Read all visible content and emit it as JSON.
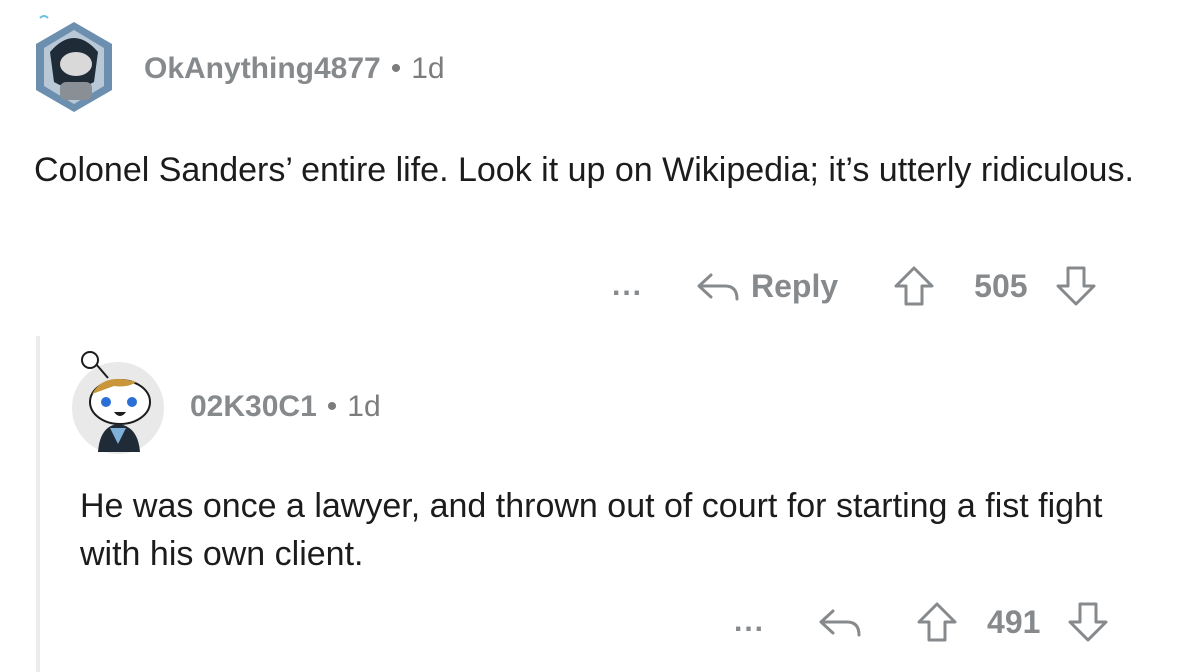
{
  "comments": [
    {
      "username": "OkAnything4877",
      "age": "1d",
      "body": "Colonel Sanders’ entire life. Look it up on Wikipedia; it’s utterly ridiculous.",
      "more": "...",
      "reply_label": "Reply",
      "score": "505"
    },
    {
      "username": "02K30C1",
      "age": "1d",
      "body": "He was once a lawyer, and thrown out of court for starting a fist fight with his own client.",
      "more": "...",
      "score": "491"
    }
  ],
  "separator": "•",
  "icons": [
    "avatar",
    "reply-icon",
    "upvote-icon",
    "downvote-icon",
    "more-icon"
  ],
  "colors": {
    "meta": "#878a8c",
    "text": "#1c1c1c",
    "thread_line": "#ececec"
  }
}
